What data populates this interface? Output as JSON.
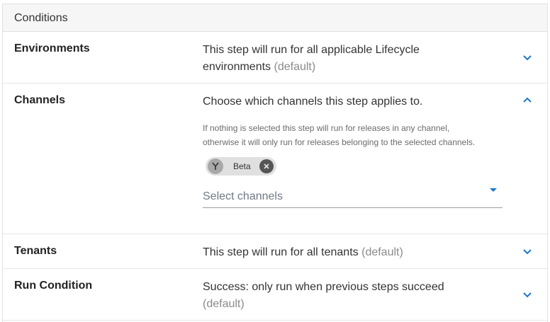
{
  "header": {
    "title": "Conditions"
  },
  "environments": {
    "title": "Environments",
    "summary": "This step will run for all applicable Lifecycle environments",
    "default_note": "(default)",
    "expand_icon": "chevron-down-icon"
  },
  "channels": {
    "title": "Channels",
    "summary": "Choose which channels this step applies to.",
    "help_line1": "If nothing is selected this step will run for releases in any channel,",
    "help_line2": "otherwise it will only run for releases belonging to the selected channels.",
    "chips": [
      {
        "label": "Beta",
        "icon": "channel-fork-icon"
      }
    ],
    "select_placeholder": "Select channels",
    "expand_icon": "chevron-up-icon"
  },
  "tenants": {
    "title": "Tenants",
    "summary": "This step will run for all tenants",
    "default_note": "(default)",
    "expand_icon": "chevron-down-icon"
  },
  "run_condition": {
    "title": "Run Condition",
    "summary": "Success: only run when previous steps succeed",
    "default_note": "(default)",
    "expand_icon": "chevron-down-icon"
  },
  "colors": {
    "accent": "#1a77ca",
    "muted_text": "#8a8a8a",
    "header_bg": "#f6f6f6",
    "chip_bg": "#e0e0e0"
  }
}
